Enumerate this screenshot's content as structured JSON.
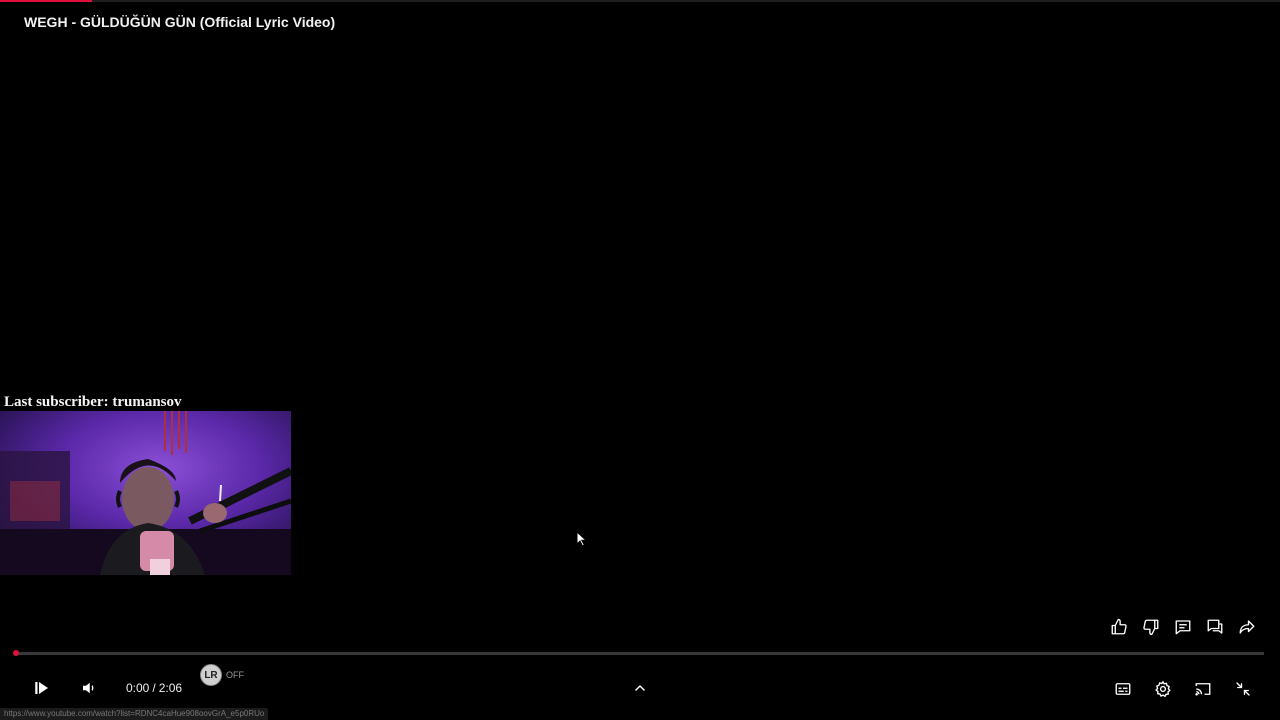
{
  "video": {
    "title": "WEGH - GÜLDÜĞÜN GÜN (Official Lyric Video)",
    "current_time": "0:00",
    "time_separator": "/",
    "duration": "2:06",
    "progress": 0.0
  },
  "overlay": {
    "subscriber_text": "Last subscriber: trumansov"
  },
  "actions": [
    {
      "name": "like-button",
      "icon": "thumb-up-icon"
    },
    {
      "name": "dislike-button",
      "icon": "thumb-down-icon"
    },
    {
      "name": "comments-button",
      "icon": "comment-icon"
    },
    {
      "name": "live-chat-button",
      "icon": "chat-bubbles-icon"
    },
    {
      "name": "share-button",
      "icon": "share-icon"
    }
  ],
  "controls": {
    "play_icon": "play-pause-icon",
    "volume_icon": "volume-icon",
    "lr_badge": "LR",
    "lr_state": "OFF",
    "chevron_icon": "chevron-up-icon",
    "right": [
      {
        "name": "subtitles-button",
        "icon": "captions-icon"
      },
      {
        "name": "settings-button",
        "icon": "gear-icon"
      },
      {
        "name": "cast-button",
        "icon": "cast-icon"
      },
      {
        "name": "exit-fullscreen-button",
        "icon": "collapse-icon"
      }
    ]
  },
  "status_bar": {
    "url": "https://www.youtube.com/watch?list=RDNC4caHue908oovGrA_e5p0RUo"
  },
  "colors": {
    "accent": "#e0103a",
    "background": "#000000"
  }
}
